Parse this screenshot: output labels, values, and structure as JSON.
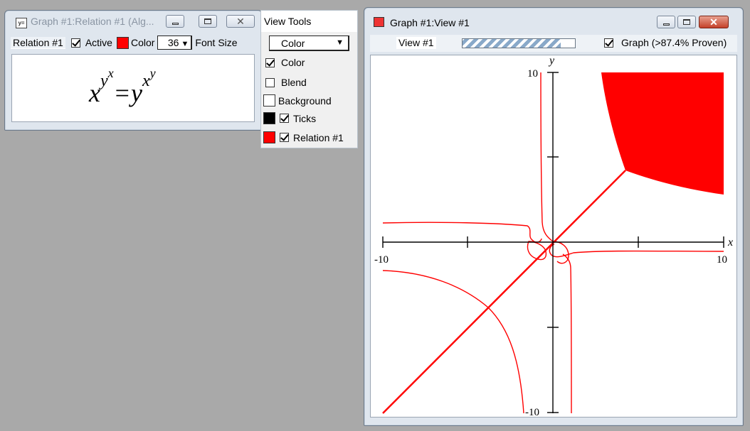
{
  "relation_window": {
    "title": "Graph #1:Relation #1 (Alg...",
    "tab_label": "Relation #1",
    "active_label": "Active",
    "active_checked": true,
    "color_label": "Color",
    "color_value": "#ff0000",
    "font_size_value": "36",
    "font_size_label": "Font Size",
    "equation": {
      "lhs_base": "x",
      "lhs_exp1": "y",
      "lhs_exp2": "x",
      "equals": "=",
      "rhs_base": "y",
      "rhs_exp1": "x",
      "rhs_exp2": "y"
    },
    "icon": "equation-window-icon"
  },
  "view_tools": {
    "title": "View Tools",
    "mode_select_value": "Color",
    "options": [
      {
        "label": "Color",
        "checked": true,
        "swatch": null
      },
      {
        "label": "Blend",
        "checked": false,
        "swatch": null
      },
      {
        "label": "Background",
        "checked": false,
        "swatch": "#ffffff"
      },
      {
        "label": "Ticks",
        "checked": true,
        "swatch": "#000000"
      },
      {
        "label": "Relation #1",
        "checked": true,
        "swatch": "#ff0000"
      }
    ]
  },
  "graph_window": {
    "title": "Graph #1:View #1",
    "tab_label": "View #1",
    "graph_checkbox_label": "Graph (>87.4% Proven)",
    "graph_checked": true,
    "proof_progress_percent": 87.4,
    "icon": "graph-window-icon"
  },
  "plot": {
    "x_axis_label": "x",
    "y_axis_label": "y",
    "x_min_label": "-10",
    "x_max_label": "10",
    "y_max_label": "10",
    "y_min_label": "-10",
    "x_range": [
      -10,
      10
    ],
    "y_range": [
      -10,
      10
    ],
    "curve_color": "#ff0000"
  }
}
